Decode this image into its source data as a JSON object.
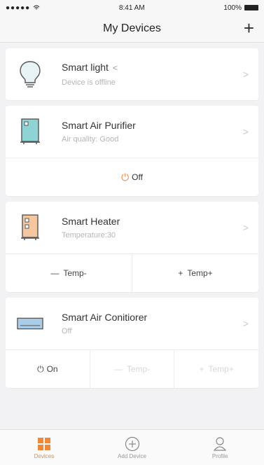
{
  "status_bar": {
    "signal": "●●●●● ",
    "time": "8:41 AM",
    "battery": "100%"
  },
  "nav": {
    "title": "My Devices",
    "add_icon": "plus-icon"
  },
  "devices": [
    {
      "name": "Smart light",
      "status": "Device is offline",
      "icon": "lightbulb-icon",
      "shared": "share-icon"
    },
    {
      "name": "Smart Air Purifier",
      "status": "Air quality: Good",
      "icon": "air-purifier-icon",
      "action_label": "Off"
    },
    {
      "name": "Smart Heater",
      "status": "Temperature:30",
      "icon": "heater-icon",
      "actions": [
        "Temp-",
        "Temp+"
      ]
    },
    {
      "name": "Smart Air Conitiorer",
      "status": "Off",
      "icon": "air-conditioner-icon",
      "actions": [
        "On",
        "Temp-",
        "Temp+"
      ]
    }
  ],
  "tabs": [
    {
      "label": "Devices",
      "icon": "grid-icon",
      "active": true
    },
    {
      "label": "Add Device",
      "icon": "plus-circle-icon",
      "active": false
    },
    {
      "label": "Profile",
      "icon": "person-icon",
      "active": false
    }
  ],
  "colors": {
    "accent": "#f0883a",
    "background": "#f2f2f4"
  }
}
